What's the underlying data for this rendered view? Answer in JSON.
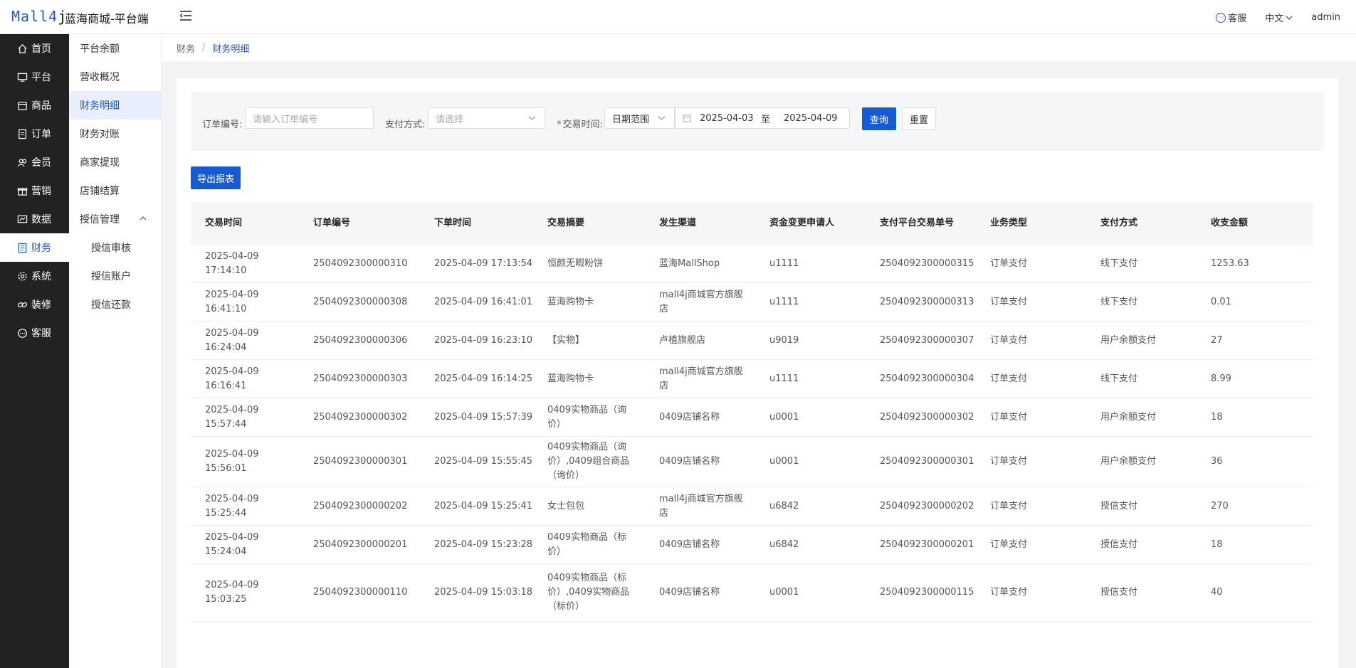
{
  "header": {
    "logo_main": "Mall4",
    "logo_j": "j",
    "app_title": "蓝海商城-平台端",
    "service_label": "客服",
    "language": "中文",
    "user": "admin"
  },
  "nav": {
    "items": [
      {
        "label": "首页",
        "icon": "home-icon"
      },
      {
        "label": "平台",
        "icon": "monitor-icon"
      },
      {
        "label": "商品",
        "icon": "box-icon"
      },
      {
        "label": "订单",
        "icon": "document-icon"
      },
      {
        "label": "会员",
        "icon": "users-icon"
      },
      {
        "label": "营销",
        "icon": "gift-icon"
      },
      {
        "label": "数据",
        "icon": "chart-icon"
      },
      {
        "label": "财务",
        "icon": "finance-icon",
        "active": true
      },
      {
        "label": "系统",
        "icon": "gear-icon"
      },
      {
        "label": "装修",
        "icon": "link-icon"
      },
      {
        "label": "客服",
        "icon": "chat-icon"
      }
    ]
  },
  "subnav": {
    "items": [
      {
        "label": "平台余额"
      },
      {
        "label": "营收概况"
      },
      {
        "label": "财务明细",
        "active": true
      },
      {
        "label": "财务对账"
      },
      {
        "label": "商家提现"
      },
      {
        "label": "店铺结算"
      },
      {
        "label": "授信管理",
        "expanded": true
      },
      {
        "label": "授信审核",
        "sub": true
      },
      {
        "label": "授信账户",
        "sub": true
      },
      {
        "label": "授信还款",
        "sub": true
      }
    ]
  },
  "breadcrumb": {
    "parent": "财务",
    "sep": "/",
    "current": "财务明细"
  },
  "filters": {
    "order_no_label": "订单编号:",
    "order_no_placeholder": "请输入订单编号",
    "pay_method_label": "支付方式:",
    "pay_method_placeholder": "请选择",
    "trade_time_star": "*",
    "trade_time_label": "交易时间:",
    "range_type": "日期范围",
    "date_start": "2025-04-03",
    "date_to": "至",
    "date_end": "2025-04-09",
    "search_btn": "查询",
    "reset_btn": "重置"
  },
  "export_btn": "导出报表",
  "table": {
    "columns": [
      "交易时间",
      "订单编号",
      "下单时间",
      "交易摘要",
      "发生渠道",
      "资金变更申请人",
      "支付平台交易单号",
      "业务类型",
      "支付方式",
      "收支金额"
    ],
    "rows": [
      {
        "time": [
          "2025-04-09",
          "17:14:10"
        ],
        "order_no": "2504092300000310",
        "order_time": "2025-04-09 17:13:54",
        "summary": [
          "恒颜无暇粉饼"
        ],
        "channel": [
          "蓝海MallShop"
        ],
        "applicant": "u1111",
        "pay_no": "2504092300000315",
        "biz_type": "订单支付",
        "pay_method": "线下支付",
        "amount": "1253.63"
      },
      {
        "time": [
          "2025-04-09",
          "16:41:10"
        ],
        "order_no": "2504092300000308",
        "order_time": "2025-04-09 16:41:01",
        "summary": [
          "蓝海购物卡"
        ],
        "channel": [
          "mall4j商城官方旗舰",
          "店"
        ],
        "applicant": "u1111",
        "pay_no": "2504092300000313",
        "biz_type": "订单支付",
        "pay_method": "线下支付",
        "amount": "0.01"
      },
      {
        "time": [
          "2025-04-09",
          "16:24:04"
        ],
        "order_no": "2504092300000306",
        "order_time": "2025-04-09 16:23:10",
        "summary": [
          "【实物】"
        ],
        "channel": [
          "卢植旗舰店"
        ],
        "applicant": "u9019",
        "pay_no": "2504092300000307",
        "biz_type": "订单支付",
        "pay_method": "用户余额支付",
        "amount": "27"
      },
      {
        "time": [
          "2025-04-09",
          "16:16:41"
        ],
        "order_no": "2504092300000303",
        "order_time": "2025-04-09 16:14:25",
        "summary": [
          "蓝海购物卡"
        ],
        "channel": [
          "mall4j商城官方旗舰",
          "店"
        ],
        "applicant": "u1111",
        "pay_no": "2504092300000304",
        "biz_type": "订单支付",
        "pay_method": "线下支付",
        "amount": "8.99"
      },
      {
        "time": [
          "2025-04-09",
          "15:57:44"
        ],
        "order_no": "2504092300000302",
        "order_time": "2025-04-09 15:57:39",
        "summary": [
          "0409实物商品（询",
          "价）"
        ],
        "channel": [
          "0409店铺名称"
        ],
        "applicant": "u0001",
        "pay_no": "2504092300000302",
        "biz_type": "订单支付",
        "pay_method": "用户余额支付",
        "amount": "18"
      },
      {
        "time": [
          "2025-04-09",
          "15:56:01"
        ],
        "order_no": "2504092300000301",
        "order_time": "2025-04-09 15:55:45",
        "summary": [
          "0409实物商品（询",
          "价）,0409组合商品",
          "（询价）"
        ],
        "channel": [
          "0409店铺名称"
        ],
        "applicant": "u0001",
        "pay_no": "2504092300000301",
        "biz_type": "订单支付",
        "pay_method": "用户余额支付",
        "amount": "36"
      },
      {
        "time": [
          "2025-04-09",
          "15:25:44"
        ],
        "order_no": "2504092300000202",
        "order_time": "2025-04-09 15:25:41",
        "summary": [
          "女士包包"
        ],
        "channel": [
          "mall4j商城官方旗舰",
          "店"
        ],
        "applicant": "u6842",
        "pay_no": "2504092300000202",
        "biz_type": "订单支付",
        "pay_method": "授信支付",
        "amount": "270"
      },
      {
        "time": [
          "2025-04-09",
          "15:24:04"
        ],
        "order_no": "2504092300000201",
        "order_time": "2025-04-09 15:23:28",
        "summary": [
          "0409实物商品（标",
          "价）"
        ],
        "channel": [
          "0409店铺名称"
        ],
        "applicant": "u6842",
        "pay_no": "2504092300000201",
        "biz_type": "订单支付",
        "pay_method": "授信支付",
        "amount": "18"
      },
      {
        "time": [
          "2025-04-09",
          "15:03:25"
        ],
        "order_no": "2504092300000110",
        "order_time": "2025-04-09 15:03:18",
        "summary": [
          "0409实物商品（标",
          "价）,0409实物商品",
          "（标价）"
        ],
        "channel": [
          "0409店铺名称"
        ],
        "applicant": "u0001",
        "pay_no": "2504092300000115",
        "biz_type": "订单支付",
        "pay_method": "授信支付",
        "amount": "40"
      }
    ]
  },
  "colors": {
    "primary": "#155bd5",
    "sidebar": "#222222",
    "active_bg": "#e8eefc"
  }
}
